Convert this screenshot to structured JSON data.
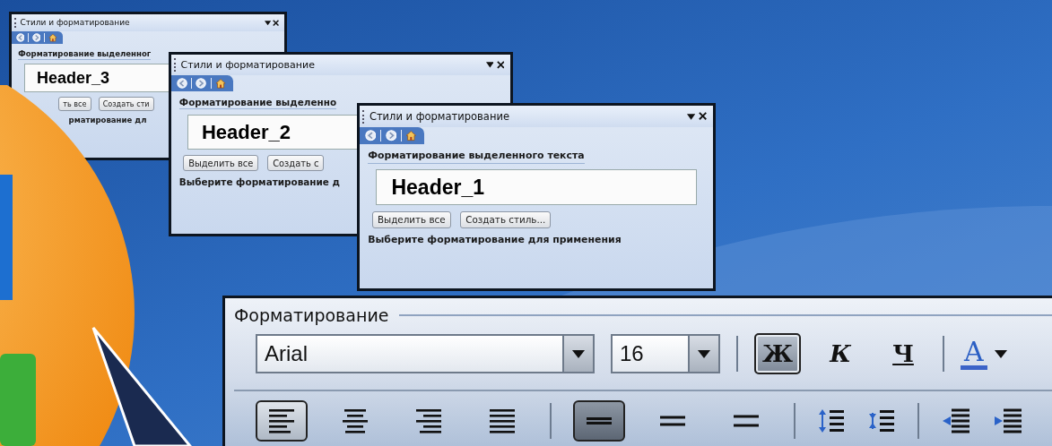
{
  "panels": [
    {
      "title": "Стили и форматирование",
      "heading": "Форматирование выделенног",
      "preview": "Header_3",
      "buttons": [
        "ть все",
        "Создать сти"
      ],
      "footer": "рматирование дл"
    },
    {
      "title": "Стили и форматирование",
      "heading": "Форматирование выделенно",
      "preview": "Header_2",
      "buttons": [
        "Выделить все",
        "Создать с"
      ],
      "footer": "Выберите форматирование д"
    },
    {
      "title": "Стили и форматирование",
      "heading": "Форматирование выделенного текста",
      "preview": "Header_1",
      "buttons": [
        "Выделить все",
        "Создать стиль..."
      ],
      "footer": "Выберите форматирование для применения"
    }
  ],
  "toolbar": {
    "title": "Форматирование",
    "font": "Arial",
    "size": "16",
    "styles": [
      {
        "label": "Ж",
        "kind": "bold",
        "selected": true
      },
      {
        "label": "К",
        "kind": "italic",
        "selected": false
      },
      {
        "label": "Ч",
        "kind": "underline",
        "selected": false
      }
    ],
    "font_color": "A",
    "alignment": [
      {
        "kind": "left",
        "selected": true
      },
      {
        "kind": "center",
        "selected": false
      },
      {
        "kind": "right",
        "selected": false
      },
      {
        "kind": "justify",
        "selected": false
      }
    ],
    "line_spacing": [
      {
        "kind": "single",
        "selected": true
      },
      {
        "kind": "one_half",
        "selected": false
      },
      {
        "kind": "double",
        "selected": false
      }
    ],
    "paragraph_spacing": [
      {
        "kind": "increase"
      },
      {
        "kind": "decrease"
      }
    ],
    "indent": [
      {
        "kind": "decrease"
      },
      {
        "kind": "increase"
      }
    ]
  }
}
